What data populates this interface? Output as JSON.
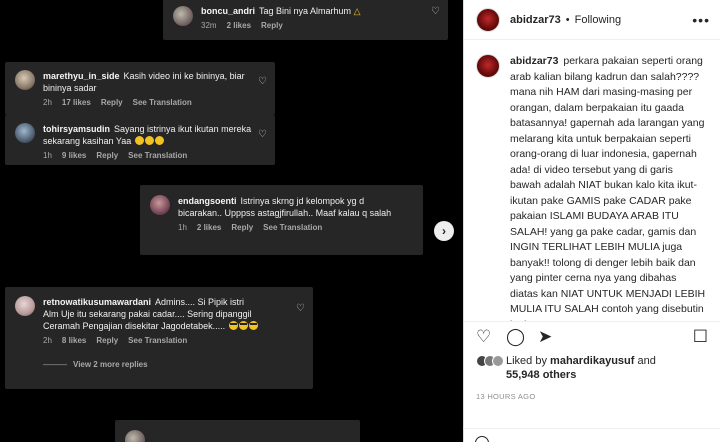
{
  "comments": [
    {
      "user": "boncu_andri",
      "text": "Tag Bini nya Almarhum",
      "emoji": "pray",
      "time": "32m",
      "likes": "2 likes",
      "reply": "Reply"
    },
    {
      "user": "marethyu_in_side",
      "text": "Kasih video ini ke bininya, biar bininya sadar",
      "time": "2h",
      "likes": "17 likes",
      "reply": "Reply",
      "translation": "See Translation"
    },
    {
      "user": "tohirsyamsudin",
      "text": "Sayang istrinya ikut ikutan mereka sekarang kasihan Yaa",
      "time": "1h",
      "likes": "9 likes",
      "reply": "Reply",
      "translation": "See Translation"
    },
    {
      "user": "endangsoenti",
      "text": "Istrinya skrng jd kelompok yg d bicarakan.. Upppss astagjfirullah.. Maaf kalau q salah",
      "time": "1h",
      "likes": "2 likes",
      "reply": "Reply",
      "translation": "See Translation"
    },
    {
      "user": "retnowatikusumawardani",
      "text": "Admins.... Si Pipik istri Alm Uje itu sekarang pakai cadar.... Sering dipanggil Ceramah Pengajian disekitar Jagodetabek.....",
      "time": "2h",
      "likes": "8 likes",
      "reply": "Reply",
      "translation": "See Translation",
      "view_replies": "View 2 more replies"
    }
  ],
  "post": {
    "username": "abidzar73",
    "follow_status": "Following",
    "more_icon": "ellipsis-icon",
    "caption_user": "abidzar73",
    "caption": "perkara pakaian seperti orang arab kalian bilang kadrun dan salah???? mana nih HAM dari masing-masing per orangan, dalam berpakaian itu gaada batasannya! gapernah ada larangan yang melarang kita untuk berpakaian seperti orang-orang di luar indonesia, gapernah ada! di video tersebut yang di garis bawah adalah NIAT bukan kalo kita ikut-ikutan pake GAMIS pake CADAR pake pakaian ISLAMI BUDAYA ARAB ITU SALAH! yang ga pake cadar, gamis dan INGIN TERLIHAT LEBIH MULIA juga banyak!! tolong di denger lebih baik dan yang pinter cerna nya yang dibahas diatas kan NIAT UNTUK MENJADI LEBIH MULIA ITU SALAH contoh yang disebutin itu baru",
    "liked_by_prefix": "Liked by",
    "liked_by_user": "mahardikayusuf",
    "liked_by_and": "and",
    "likes_count": "55,948 others",
    "timestamp": "13 HOURS AGO"
  },
  "icons": [
    "heart-icon",
    "comment-icon",
    "share-icon",
    "bookmark-icon",
    "chevron-right-icon",
    "emoji-icon"
  ],
  "colors": {
    "image_bg": "#000000",
    "card_bg": "#262626",
    "panel_bg": "#ffffff",
    "meta": "#a8a8a8"
  }
}
